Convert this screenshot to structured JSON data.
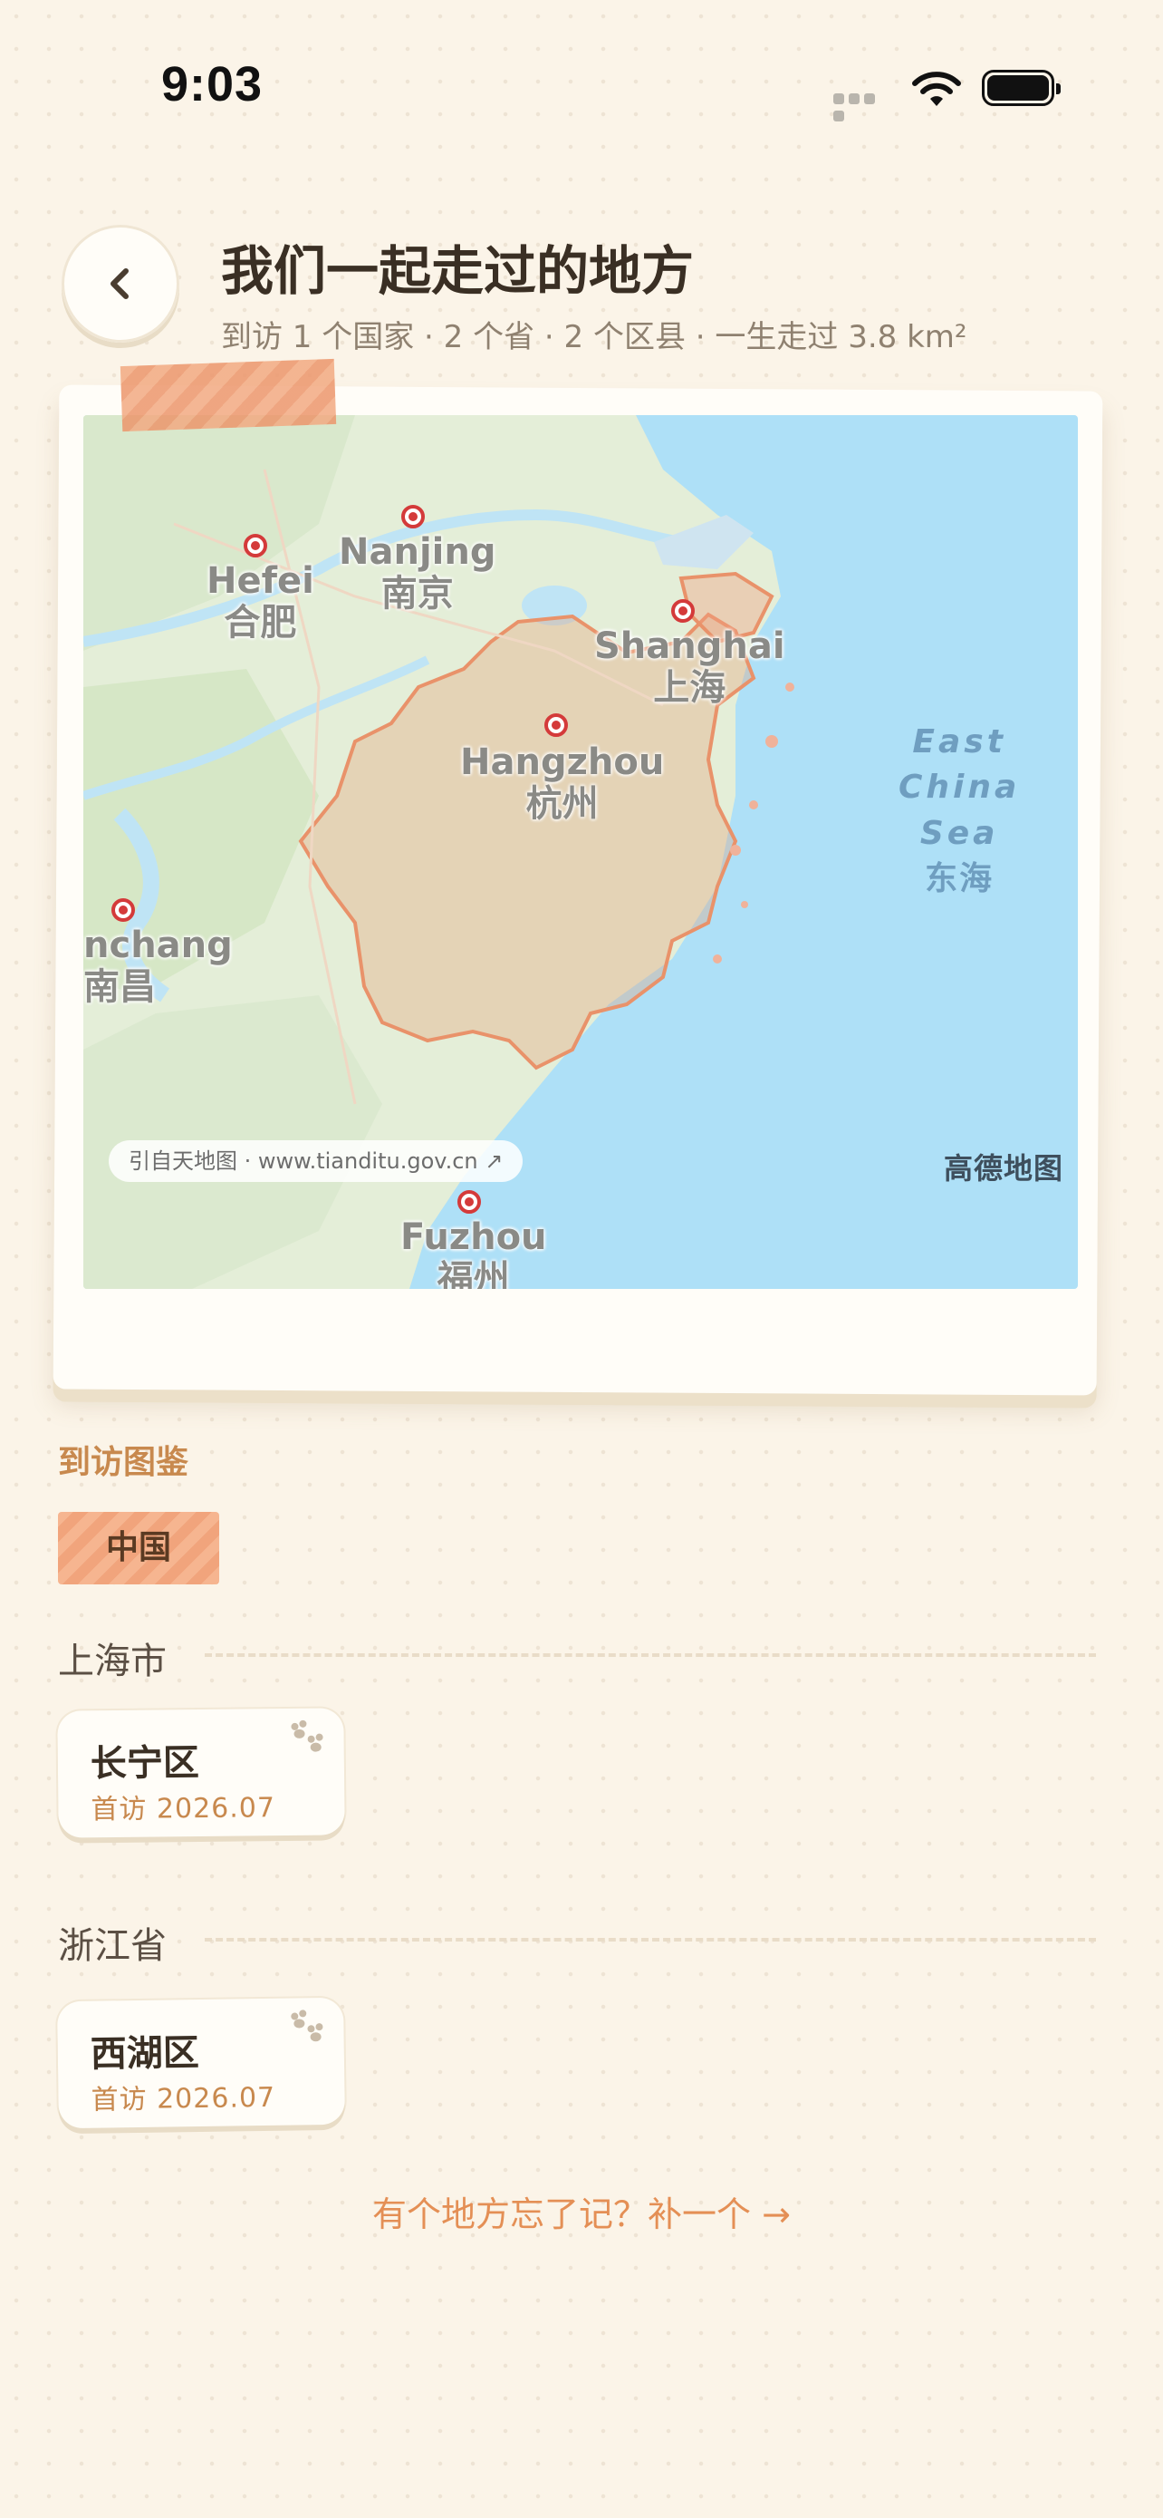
{
  "status_bar": {
    "time": "9:03"
  },
  "header": {
    "title": "我们一起走过的地方",
    "subtitle": "到访 1 个国家 · 2 个省 · 2 个区县 · 一生走过 3.8 km²"
  },
  "map": {
    "cities": [
      {
        "en": "Hefei",
        "zh": "合肥"
      },
      {
        "en": "Nanjing",
        "zh": "南京"
      },
      {
        "en": "Shanghai",
        "zh": "上海"
      },
      {
        "en": "Hangzhou",
        "zh": "杭州"
      },
      {
        "en": "nchang",
        "zh": "南昌"
      },
      {
        "en": "Fuzhou",
        "zh": "福州"
      }
    ],
    "sea": {
      "line1": "East",
      "line2": "China",
      "line3": "Sea",
      "zh": "东海"
    },
    "attribution": "引自天地图 · www.tianditu.gov.cn ↗",
    "provider_logo": "高德地图",
    "highlight_color": "#e9926a",
    "land_color": "#e4eed8",
    "water_color": "#aee0f7"
  },
  "collection": {
    "title": "到访图鉴",
    "country_chip": "中国",
    "regions": [
      {
        "name": "上海市",
        "places": [
          {
            "name": "长宁区",
            "first_visit": "首访 2026.07"
          }
        ]
      },
      {
        "name": "浙江省",
        "places": [
          {
            "name": "西湖区",
            "first_visit": "首访 2026.07"
          }
        ]
      }
    ]
  },
  "footer_link": "有个地方忘了记？补一个 →",
  "colors": {
    "background": "#fbf4e8",
    "accent": "#e48f55",
    "section_title": "#c8894e"
  }
}
